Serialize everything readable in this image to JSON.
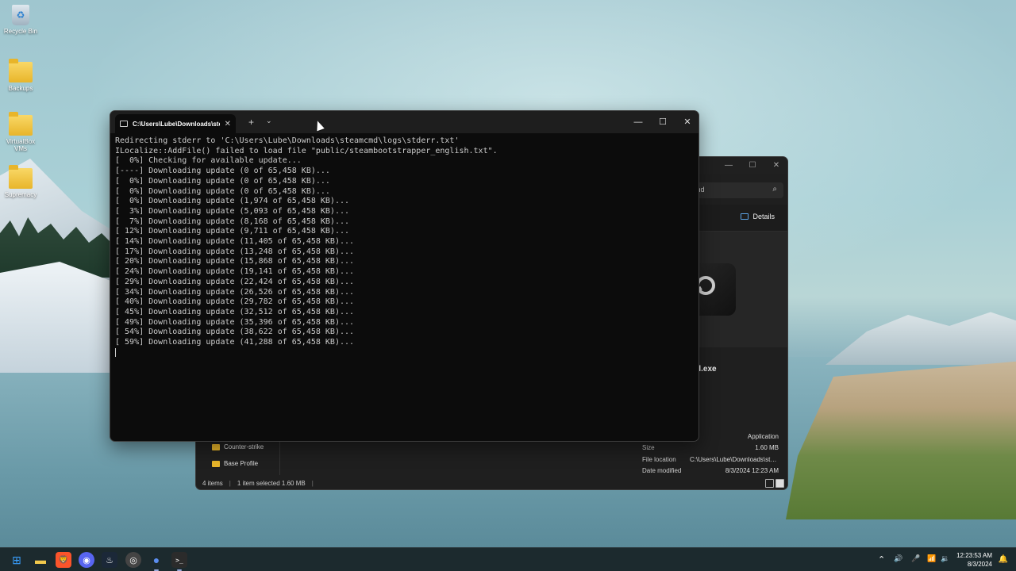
{
  "desktop": {
    "icons": [
      {
        "label": "Recycle Bin",
        "glyph": "♻"
      },
      {
        "label": "Backups"
      },
      {
        "label": "VirtualBox VMs"
      },
      {
        "label": "Supremacy"
      }
    ]
  },
  "terminal": {
    "tab_title": "C:\\Users\\Lube\\Downloads\\ste",
    "tab_close": "✕",
    "new_tab": "+",
    "dropdown": "⌄",
    "minimize": "—",
    "maximize": "☐",
    "close": "✕",
    "output": "Redirecting stderr to 'C:\\Users\\Lube\\Downloads\\steamcmd\\logs\\stderr.txt'\nILocalize::AddFile() failed to load file \"public/steambootstrapper_english.txt\".\n[  0%] Checking for available update...\n[----] Downloading update (0 of 65,458 KB)...\n[  0%] Downloading update (0 of 65,458 KB)...\n[  0%] Downloading update (0 of 65,458 KB)...\n[  0%] Downloading update (1,974 of 65,458 KB)...\n[  3%] Downloading update (5,093 of 65,458 KB)...\n[  7%] Downloading update (8,168 of 65,458 KB)...\n[ 12%] Downloading update (9,711 of 65,458 KB)...\n[ 14%] Downloading update (11,405 of 65,458 KB)...\n[ 17%] Downloading update (13,248 of 65,458 KB)...\n[ 20%] Downloading update (15,868 of 65,458 KB)...\n[ 24%] Downloading update (19,141 of 65,458 KB)...\n[ 29%] Downloading update (22,424 of 65,458 KB)...\n[ 34%] Downloading update (26,526 of 65,458 KB)...\n[ 40%] Downloading update (29,782 of 65,458 KB)...\n[ 45%] Downloading update (32,512 of 65,458 KB)...\n[ 49%] Downloading update (35,396 of 65,458 KB)...\n[ 54%] Downloading update (38,622 of 65,458 KB)...\n[ 59%] Downloading update (41,288 of 65,458 KB)..."
  },
  "explorer": {
    "minimize": "—",
    "maximize": "☐",
    "close": "✕",
    "search_value": "md",
    "search_glyph": "⌕",
    "details_label": "Details",
    "filename": "d.exe",
    "nav_items": [
      "Counter-strike",
      "Base Profile"
    ],
    "properties": [
      {
        "label": "",
        "value": "Application"
      },
      {
        "label": "Size",
        "value": "1.60 MB"
      },
      {
        "label": "File location",
        "value": "C:\\Users\\Lube\\Downloads\\ste..."
      },
      {
        "label": "Date modified",
        "value": "8/3/2024 12:23 AM"
      }
    ],
    "status": {
      "items": "4 items",
      "selected": "1 item selected  1.60 MB"
    }
  },
  "taskbar": {
    "clock_time": "12:23:53 AM",
    "clock_date": "8/3/2024",
    "tray": {
      "chevron": "⌃",
      "speaker_a": "🔊",
      "mic": "🎤",
      "wifi": "📶",
      "speaker_b": "🔉",
      "bell": "🔔"
    },
    "apps": [
      {
        "glyph": "⊞",
        "color": "#3aa0ff"
      },
      {
        "glyph": "▬",
        "color": "#f2c94c"
      },
      {
        "glyph": "🦁",
        "color": "#fb542b"
      },
      {
        "glyph": "◉",
        "color": "#5865f2"
      },
      {
        "glyph": "♨",
        "color": "#1b2838"
      },
      {
        "glyph": "◎",
        "color": "#444"
      },
      {
        "glyph": "●",
        "color": "#5b8def"
      },
      {
        "glyph": ">_",
        "color": "#2b2b2b"
      }
    ]
  }
}
